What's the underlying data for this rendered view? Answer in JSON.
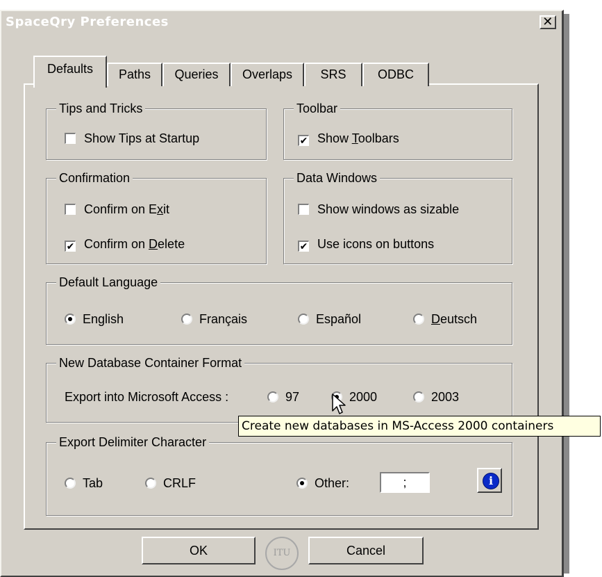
{
  "window": {
    "title": "SpaceQry Preferences",
    "close_glyph": "✕"
  },
  "tabs": [
    "Defaults",
    "Paths",
    "Queries",
    "Overlaps",
    "SRS",
    "ODBC"
  ],
  "tips": {
    "legend": "Tips and Tricks",
    "show_tips": {
      "label": "Show Tips at Startup",
      "checked": false
    }
  },
  "toolbar": {
    "legend": "Toolbar",
    "show_toolbars": {
      "pre": "Show ",
      "u": "T",
      "post": "oolbars",
      "checked": true
    }
  },
  "confirmation": {
    "legend": "Confirmation",
    "exit": {
      "pre": "Confirm on E",
      "u": "x",
      "post": "it",
      "checked": false
    },
    "delete": {
      "pre": "Confirm on ",
      "u": "D",
      "post": "elete",
      "checked": true
    }
  },
  "data_windows": {
    "legend": "Data Windows",
    "sizable": {
      "label": "Show windows as sizable",
      "checked": false
    },
    "icons": {
      "label": "Use icons on buttons",
      "checked": true
    }
  },
  "language": {
    "legend": "Default Language",
    "options": [
      "English",
      "Français",
      "Español",
      "Deutsch"
    ],
    "deutsch_u": "D",
    "deutsch_rest": "eutsch",
    "selected": "English"
  },
  "db_format": {
    "legend": "New Database Container Format",
    "label": "Export into Microsoft Access :",
    "options": [
      "97",
      "2000",
      "2003"
    ],
    "selected": "2000"
  },
  "delimiter": {
    "legend": "Export Delimiter Character",
    "options": [
      "Tab",
      "CRLF",
      "Other:"
    ],
    "selected": "Other:",
    "other_value": ";"
  },
  "buttons": {
    "ok": "OK",
    "cancel": "Cancel"
  },
  "logo_text": "ITU",
  "tooltip": "Create new databases in MS-Access 2000 containers",
  "icons": {
    "info": "info-icon",
    "cursor": "arrow-cursor-icon"
  },
  "colors": {
    "face": "#d4d0c8",
    "tooltip_bg": "#ffffe1",
    "info_blue": "#0a2ac8"
  }
}
